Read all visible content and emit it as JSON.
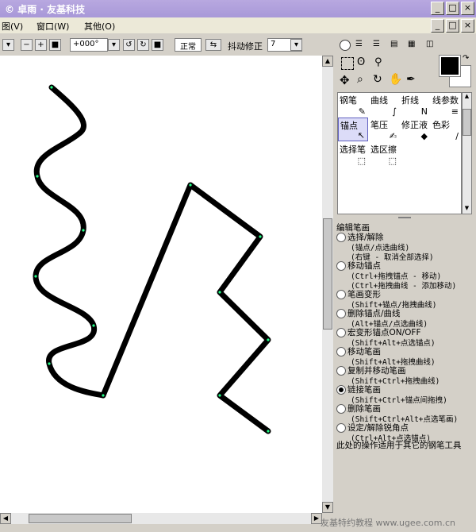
{
  "window": {
    "title": "© 卓雨 · 友基科技"
  },
  "menu": {
    "items": [
      "图(V)",
      "窗口(W)",
      "其他(O)"
    ]
  },
  "toolbar": {
    "rotation": "+000°",
    "blend_mode": "正常",
    "stabilizer_label": "抖动修正",
    "stabilizer_value": "7"
  },
  "tools": {
    "row1": [
      "钢笔",
      "曲线",
      "折线",
      "线参数"
    ],
    "row2": [
      "锚点",
      "笔压",
      "修正液",
      "色彩"
    ],
    "row3": [
      "选择笔",
      "选区擦"
    ]
  },
  "options": {
    "title": "编辑笔画",
    "items": [
      {
        "label": "选择/解除",
        "hints": [
          "(锚点/点选曲线)",
          "(右键 - 取消全部选择)"
        ],
        "selected": false
      },
      {
        "label": "移动锚点",
        "hints": [
          "(Ctrl+拖拽锚点 - 移动)",
          "(Ctrl+拖拽曲线 - 添加移动)"
        ],
        "selected": false
      },
      {
        "label": "笔画变形",
        "hints": [
          "(Shift+锚点/拖拽曲线)"
        ],
        "selected": false
      },
      {
        "label": "删除锚点/曲线",
        "hints": [
          "(Alt+锚点/点选曲线)"
        ],
        "selected": false
      },
      {
        "label": "宏变形锚点ON/OFF",
        "hints": [
          "(Shift+Alt+点选锚点)"
        ],
        "selected": false
      },
      {
        "label": "移动笔画",
        "hints": [
          "(Shift+Alt+拖拽曲线)"
        ],
        "selected": false
      },
      {
        "label": "复制并移动笔画",
        "hints": [
          "(Shift+Ctrl+拖拽曲线)"
        ],
        "selected": false
      },
      {
        "label": "链接笔画",
        "hints": [
          "(Shift+Ctrl+锚点间拖拽)"
        ],
        "selected": true
      },
      {
        "label": "删除笔画",
        "hints": [
          "(Shift+Ctrl+Alt+点选笔画)"
        ],
        "selected": false
      },
      {
        "label": "设定/解除锐角点",
        "hints": [
          "(Ctrl+Alt+点选锚点)"
        ],
        "selected": false
      }
    ],
    "footer": "此处的操作适用于其它的钢笔工具"
  },
  "colors": {
    "foreground": "#000000",
    "background": "#ffffff",
    "title_bar": "#a898d8"
  },
  "watermark": "友基特约教程  www.ugee.com.cn"
}
